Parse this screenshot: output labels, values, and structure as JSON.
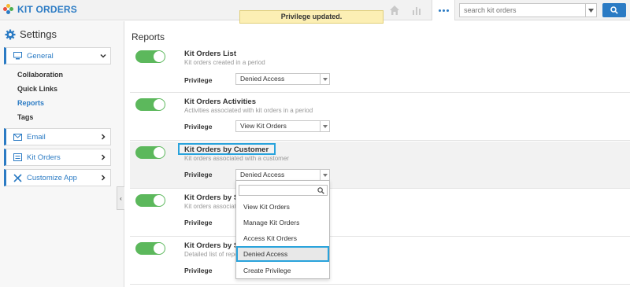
{
  "app": {
    "title": "KIT ORDERS"
  },
  "toast": {
    "message": "Privilege updated."
  },
  "header": {
    "search_placeholder": "search kit orders",
    "icons": [
      "home-icon",
      "bar-chart-icon",
      "more-icon",
      "search-icon"
    ]
  },
  "sidebar": {
    "title": "Settings",
    "general": "General",
    "sub_items": [
      "Collaboration",
      "Quick Links",
      "Reports",
      "Tags"
    ],
    "active_sub": "Reports",
    "sections": [
      "Email",
      "Kit Orders",
      "Customize App"
    ],
    "collapse_glyph": "‹"
  },
  "main": {
    "title": "Reports",
    "privilege_label": "Privilege",
    "rows": [
      {
        "title": "Kit Orders List",
        "desc": "Kit orders created in a period",
        "privilege": "Denied Access",
        "enabled": true
      },
      {
        "title": "Kit Orders Activities",
        "desc": "Activities associated with kit orders in a period",
        "privilege": "View Kit Orders",
        "enabled": true
      },
      {
        "title": "Kit Orders by Customer",
        "desc": "Kit orders associated with a customer",
        "privilege": "Denied Access",
        "enabled": true
      },
      {
        "title": "Kit Orders by S",
        "desc": "Kit orders associat",
        "privilege": "",
        "enabled": true
      },
      {
        "title": "Kit Orders by S",
        "desc": "Detailed list of repo",
        "privilege": "",
        "enabled": true
      }
    ]
  },
  "dropdown": {
    "options": [
      "View Kit Orders",
      "Manage Kit Orders",
      "Access Kit Orders",
      "Denied Access",
      "Create Privilege"
    ],
    "selected": "Denied Access"
  },
  "colors": {
    "accent": "#2b7bc4",
    "toggle_on": "#5cb85c",
    "highlight": "#29a3dc",
    "toast_bg": "#fcefb4"
  }
}
